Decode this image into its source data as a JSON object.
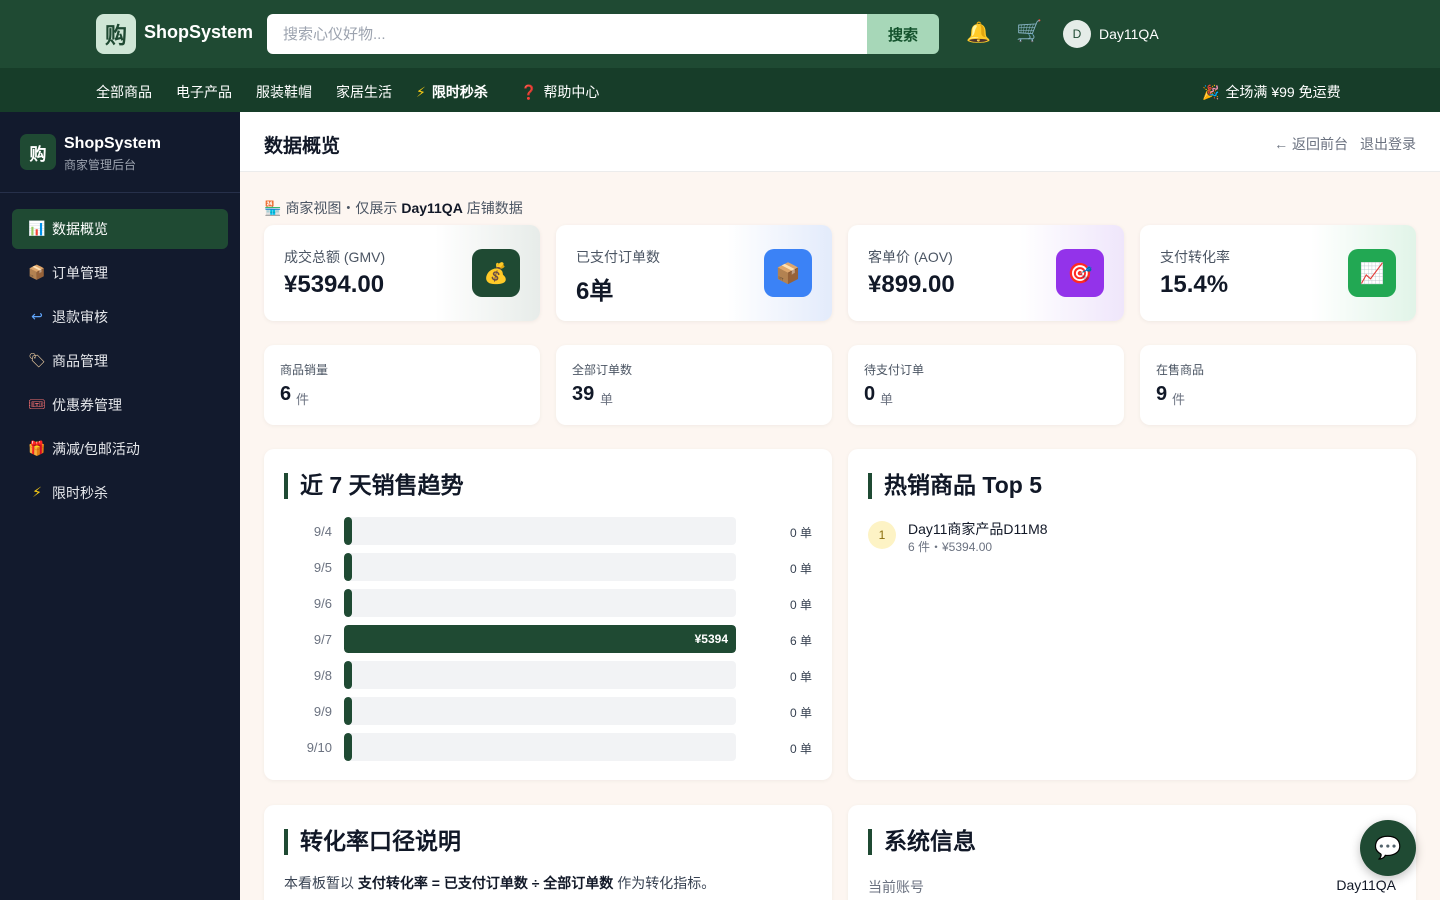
{
  "header": {
    "logo_char": "购",
    "brand": "ShopSystem",
    "search_placeholder": "搜索心仪好物...",
    "search_button": "搜索",
    "bell_icon": "🔔",
    "cart_icon": "🛒",
    "avatar_initial": "D",
    "username": "Day11QA"
  },
  "category_nav": {
    "items": [
      {
        "label": "全部商品",
        "icon": ""
      },
      {
        "label": "电子产品",
        "icon": ""
      },
      {
        "label": "服装鞋帽",
        "icon": ""
      },
      {
        "label": "家居生活",
        "icon": ""
      },
      {
        "label": "限时秒杀",
        "icon": "⚡"
      },
      {
        "label": "帮助中心",
        "icon": "❓"
      }
    ],
    "promo_icon": "🎉",
    "promo_text": "全场满 ¥99 免运费"
  },
  "sidebar": {
    "logo_char": "购",
    "title": "ShopSystem",
    "subtitle": "商家管理后台",
    "items": [
      {
        "label": "数据概览",
        "icon": "📊",
        "active": true
      },
      {
        "label": "订单管理",
        "icon": "📦",
        "active": false
      },
      {
        "label": "退款审核",
        "icon": "↩",
        "active": false
      },
      {
        "label": "商品管理",
        "icon": "🏷",
        "active": false
      },
      {
        "label": "优惠券管理",
        "icon": "🎟",
        "active": false
      },
      {
        "label": "满减/包邮活动",
        "icon": "🎁",
        "active": false
      },
      {
        "label": "限时秒杀",
        "icon": "⚡",
        "active": false
      }
    ]
  },
  "main_header": {
    "title": "数据概览",
    "back_link": "← 返回前台",
    "logout": "退出登录"
  },
  "scope_note": {
    "icon": "🏪",
    "prefix": "商家视图・仅展示",
    "store": "Day11QA",
    "suffix": "店铺数据"
  },
  "kpis": [
    {
      "label": "成交总额 (GMV)",
      "value": "¥5394.00",
      "icon": "💰",
      "color": "#1f4a33"
    },
    {
      "label": "已支付订单数",
      "value": "6单",
      "icon": "📦",
      "color": "#3b82f6"
    },
    {
      "label": "客单价 (AOV)",
      "value": "¥899.00",
      "icon": "🎯",
      "color": "#9333ea"
    },
    {
      "label": "支付转化率",
      "value": "15.4%",
      "icon": "📈",
      "color": "#22a853"
    }
  ],
  "stats": [
    {
      "label": "商品销量",
      "value": "6",
      "unit": "件"
    },
    {
      "label": "全部订单数",
      "value": "39",
      "unit": "单"
    },
    {
      "label": "待支付订单",
      "value": "0",
      "unit": "单"
    },
    {
      "label": "在售商品",
      "value": "9",
      "unit": "件"
    }
  ],
  "trend": {
    "title": "近 7 天销售趋势"
  },
  "chart_data": {
    "type": "bar",
    "title": "近 7 天销售趋势",
    "categories": [
      "9/4",
      "9/5",
      "9/6",
      "9/7",
      "9/8",
      "9/9",
      "9/10"
    ],
    "series": [
      {
        "values": [
          0,
          0,
          0,
          5394,
          0,
          0,
          0
        ]
      }
    ],
    "amount_labels": [
      "",
      "",
      "",
      "¥5394",
      "",
      "",
      ""
    ],
    "order_counts": [
      "0 单",
      "0 单",
      "0 单",
      "6 单",
      "0 单",
      "0 单",
      "0 单"
    ],
    "orientation": "horizontal"
  },
  "top5": {
    "title": "热销商品 Top 5",
    "items": [
      {
        "rank": "1",
        "name": "Day11商家产品D11M8",
        "meta": "6 件・¥5394.00"
      }
    ]
  },
  "conversion": {
    "title": "转化率口径说明",
    "text_pre": "本看板暂以",
    "text_b1": "支付转化率 = 已支付订单数 ÷ 全部订单数",
    "text_post": "作为转化指标。"
  },
  "system": {
    "title": "系统信息",
    "account_label": "当前账号",
    "account_value": "Day11QA"
  },
  "chat_icon": "💬"
}
